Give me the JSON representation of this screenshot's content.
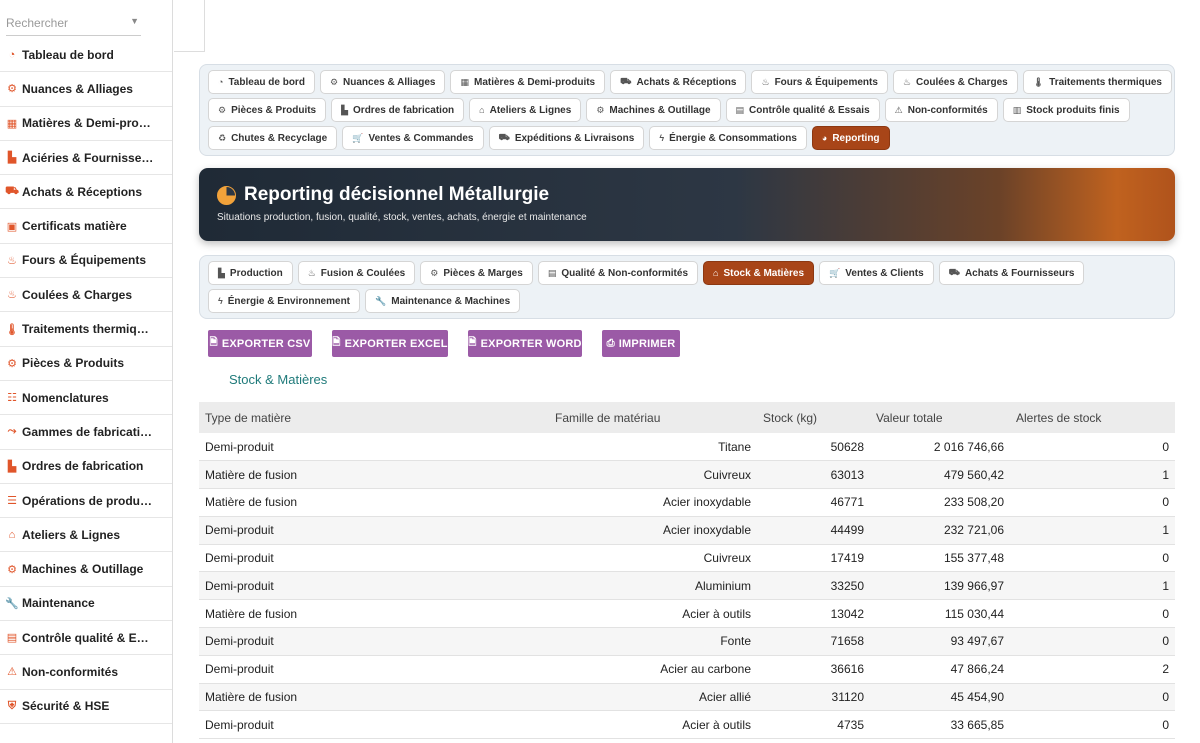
{
  "search": {
    "placeholder": "Rechercher"
  },
  "sidebar": {
    "items": [
      {
        "label": "Tableau de bord",
        "icon": "dashboard-icon"
      },
      {
        "label": "Nuances & Alliages",
        "icon": "gear-icon"
      },
      {
        "label": "Matières & Demi-pro…",
        "icon": "cubes-icon"
      },
      {
        "label": "Aciéries & Fournisse…",
        "icon": "industry-icon"
      },
      {
        "label": "Achats & Réceptions",
        "icon": "truck-icon"
      },
      {
        "label": "Certificats matière",
        "icon": "certificate-icon"
      },
      {
        "label": "Fours & Équipements",
        "icon": "fire-icon"
      },
      {
        "label": "Coulées & Charges",
        "icon": "fire-burner-icon"
      },
      {
        "label": "Traitements thermiq…",
        "icon": "thermometer-icon"
      },
      {
        "label": "Pièces & Produits",
        "icon": "cog-icon"
      },
      {
        "label": "Nomenclatures",
        "icon": "sitemap-icon"
      },
      {
        "label": "Gammes de fabricati…",
        "icon": "route-icon"
      },
      {
        "label": "Ordres de fabrication",
        "icon": "industry-icon"
      },
      {
        "label": "Opérations de produ…",
        "icon": "list-icon"
      },
      {
        "label": "Ateliers & Lignes",
        "icon": "warehouse-icon"
      },
      {
        "label": "Machines & Outillage",
        "icon": "cogs-icon"
      },
      {
        "label": "Maintenance",
        "icon": "wrench-icon"
      },
      {
        "label": "Contrôle qualité & E…",
        "icon": "clipboard-check-icon"
      },
      {
        "label": "Non-conformités",
        "icon": "warning-icon"
      },
      {
        "label": "Sécurité & HSE",
        "icon": "shield-icon"
      }
    ]
  },
  "main_tabs": {
    "rows": [
      [
        {
          "label": "Tableau de bord",
          "icon": "dashboard-icon"
        },
        {
          "label": "Nuances & Alliages",
          "icon": "gear-icon"
        },
        {
          "label": "Matières & Demi-produits",
          "icon": "cubes-icon"
        },
        {
          "label": "Achats & Réceptions",
          "icon": "truck-icon"
        },
        {
          "label": "Fours & Équipements",
          "icon": "fire-icon"
        },
        {
          "label": "Coulées & Charges",
          "icon": "fire-burner-icon"
        },
        {
          "label": "Traitements thermiques",
          "icon": "thermometer-icon"
        }
      ],
      [
        {
          "label": "Pièces & Produits",
          "icon": "cog-icon"
        },
        {
          "label": "Ordres de fabrication",
          "icon": "industry-icon"
        },
        {
          "label": "Ateliers & Lignes",
          "icon": "warehouse-icon"
        },
        {
          "label": "Machines & Outillage",
          "icon": "cogs-icon"
        },
        {
          "label": "Contrôle qualité & Essais",
          "icon": "clipboard-check-icon"
        },
        {
          "label": "Non-conformités",
          "icon": "warning-icon"
        },
        {
          "label": "Stock produits finis",
          "icon": "boxes-icon"
        }
      ],
      [
        {
          "label": "Chutes & Recyclage",
          "icon": "recycle-icon"
        },
        {
          "label": "Ventes & Commandes",
          "icon": "cart-icon"
        },
        {
          "label": "Expéditions & Livraisons",
          "icon": "shipping-icon"
        },
        {
          "label": "Énergie & Consommations",
          "icon": "bolt-icon"
        },
        {
          "label": "Reporting",
          "icon": "pie-chart-icon",
          "active": true
        }
      ]
    ]
  },
  "banner": {
    "title": "Reporting décisionnel Métallurgie",
    "subtitle": "Situations production, fusion, qualité, stock, ventes, achats, énergie et maintenance"
  },
  "report_tabs": {
    "rows": [
      [
        {
          "label": "Production",
          "icon": "industry-icon"
        },
        {
          "label": "Fusion & Coulées",
          "icon": "fire-burner-icon"
        },
        {
          "label": "Pièces & Marges",
          "icon": "cog-icon"
        },
        {
          "label": "Qualité & Non-conformités",
          "icon": "clipboard-check-icon"
        },
        {
          "label": "Stock & Matières",
          "icon": "warehouse-icon",
          "active": true
        },
        {
          "label": "Ventes & Clients",
          "icon": "cart-icon"
        },
        {
          "label": "Achats & Fournisseurs",
          "icon": "truck-icon"
        }
      ],
      [
        {
          "label": "Énergie & Environnement",
          "icon": "bolt-icon"
        },
        {
          "label": "Maintenance & Machines",
          "icon": "wrench-icon"
        }
      ]
    ]
  },
  "export": {
    "csv": "EXPORTER CSV",
    "excel": "EXPORTER EXCEL",
    "word": "EXPORTER WORD",
    "print": "IMPRIMER"
  },
  "section_title": "Stock & Matières",
  "table": {
    "headers": [
      "Type de matière",
      "Famille de matériau",
      "Stock (kg)",
      "Valeur totale",
      "Alertes de stock"
    ],
    "rows": [
      [
        "Demi-produit",
        "Titane",
        "50628",
        "2 016 746,66",
        "0"
      ],
      [
        "Matière de fusion",
        "Cuivreux",
        "63013",
        "479 560,42",
        "1"
      ],
      [
        "Matière de fusion",
        "Acier inoxydable",
        "46771",
        "233 508,20",
        "0"
      ],
      [
        "Demi-produit",
        "Acier inoxydable",
        "44499",
        "232 721,06",
        "1"
      ],
      [
        "Demi-produit",
        "Cuivreux",
        "17419",
        "155 377,48",
        "0"
      ],
      [
        "Demi-produit",
        "Aluminium",
        "33250",
        "139 966,97",
        "1"
      ],
      [
        "Matière de fusion",
        "Acier à outils",
        "13042",
        "115 030,44",
        "0"
      ],
      [
        "Demi-produit",
        "Fonte",
        "71658",
        "93 497,67",
        "0"
      ],
      [
        "Demi-produit",
        "Acier au carbone",
        "36616",
        "47 866,24",
        "2"
      ],
      [
        "Matière de fusion",
        "Acier allié",
        "31120",
        "45 454,90",
        "0"
      ],
      [
        "Demi-produit",
        "Acier à outils",
        "4735",
        "33 665,85",
        "0"
      ]
    ]
  }
}
